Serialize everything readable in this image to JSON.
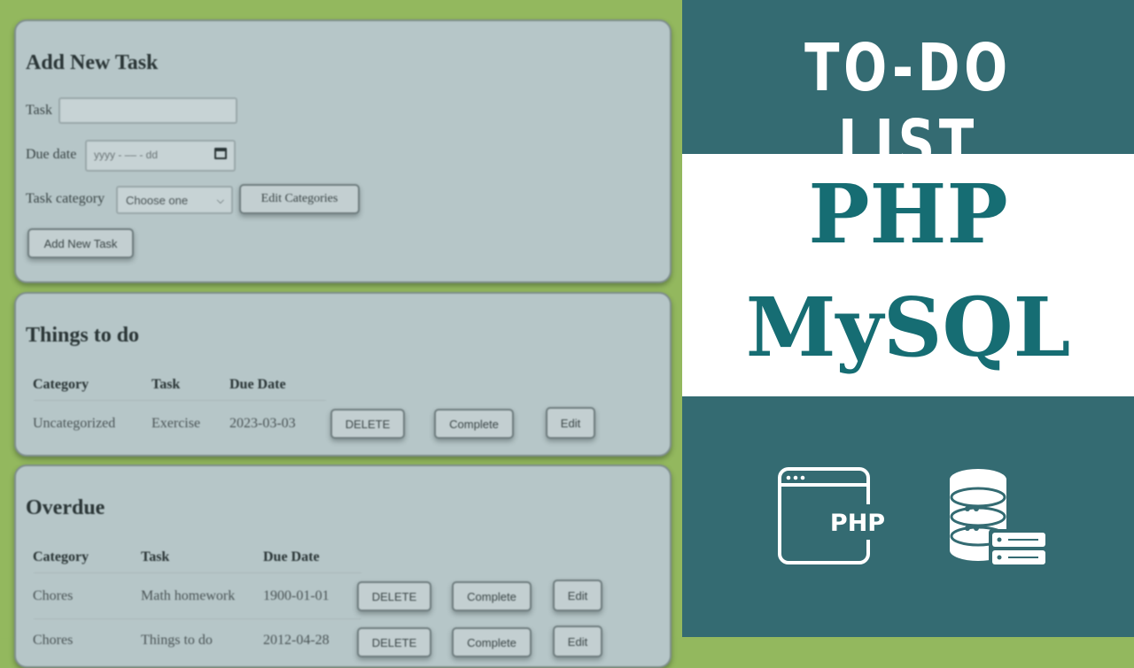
{
  "add_task": {
    "heading": "Add New Task",
    "task_label": "Task",
    "task_value": "",
    "due_label": "Due date",
    "due_placeholder": "yyyy - ‒‒ - dd",
    "category_label": "Task category",
    "category_selected": "Choose one",
    "edit_categories_label": "Edit Categories",
    "add_button_label": "Add New Task"
  },
  "things_to_do": {
    "heading": "Things to do",
    "columns": [
      "Category",
      "Task",
      "Due Date"
    ],
    "rows": [
      {
        "category": "Uncategorized",
        "task": "Exercise",
        "due": "2023-03-03"
      }
    ]
  },
  "overdue": {
    "heading": "Overdue",
    "columns": [
      "Category",
      "Task",
      "Due Date"
    ],
    "rows": [
      {
        "category": "Chores",
        "task": "Math homework",
        "due": "1900-01-01"
      },
      {
        "category": "Chores",
        "task": "Things to do",
        "due": "2012-04-28"
      }
    ]
  },
  "actions": {
    "delete": "DELETE",
    "complete": "Complete",
    "edit": "Edit"
  },
  "banner": {
    "title": "TO-DO LIST",
    "line1": "PHP",
    "line2": "MySQL",
    "php_icon_text": "PHP"
  },
  "icons": [
    "calendar-icon",
    "chevron-down-icon",
    "browser-php-icon",
    "database-server-icon"
  ],
  "colors": {
    "page_bg": "#93b85e",
    "card_bg": "#b6c6c8",
    "banner_bg": "#346b72",
    "banner_text": "#166d73"
  }
}
